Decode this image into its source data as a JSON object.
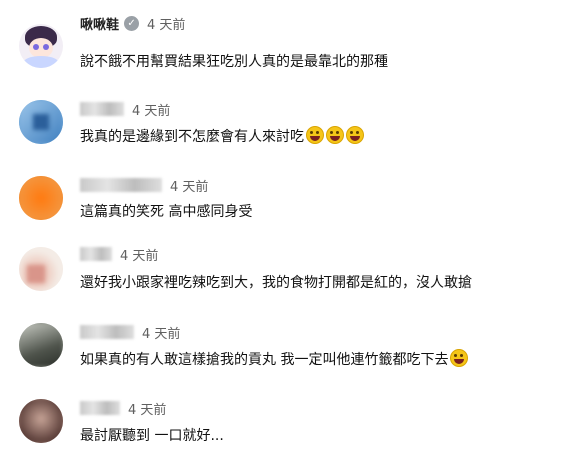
{
  "comments": [
    {
      "author": "啾啾鞋",
      "verified": true,
      "time": "4 天前",
      "text": "說不餓不用幫買結果狂吃別人真的是最靠北的那種",
      "emoji_count": 0
    },
    {
      "author": "",
      "verified": false,
      "time": "4 天前",
      "text": "我真的是邊緣到不怎麼會有人來討吃",
      "emoji_count": 3
    },
    {
      "author": "",
      "verified": false,
      "time": "4 天前",
      "text": "這篇真的笑死 高中感同身受",
      "emoji_count": 0
    },
    {
      "author": "",
      "verified": false,
      "time": "4 天前",
      "text": "還好我小跟家裡吃辣吃到大，我的食物打開都是紅的，沒人敢搶",
      "emoji_count": 0
    },
    {
      "author": "",
      "verified": false,
      "time": "4 天前",
      "text": "如果真的有人敢這樣搶我的貢丸 我一定叫他連竹籤都吃下去",
      "emoji_count": 1
    },
    {
      "author": "",
      "verified": false,
      "time": "4 天前",
      "text": "最討厭聽到 一口就好...",
      "emoji_count": 0
    }
  ],
  "icons": {
    "verified": "check-icon",
    "emoji": "grinning-face-icon"
  },
  "colors": {
    "timestamp": "#606060",
    "text": "#111111",
    "emoji": "#f5c518"
  }
}
